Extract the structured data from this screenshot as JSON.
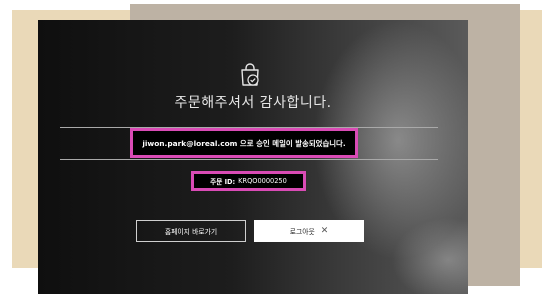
{
  "modal": {
    "title": "주문해주셔서 감사합니다.",
    "email_address": "jiwon.park@loreal.com",
    "email_message": " 으로 승인 메일이 발송되었습니다.",
    "order_id_label": "주문 ID:",
    "order_id_value": "KRQO0000250"
  },
  "buttons": {
    "home_label": "홈페이지 바로가기",
    "logout_label": "로그아웃",
    "logout_close_glyph": "✕"
  },
  "colors": {
    "highlight": "#d94bb5",
    "beige_backdrop": "#ead9b8",
    "taupe_backdrop": "#bdb2a4"
  },
  "icons": {
    "header": "shopping-bag-check-icon"
  }
}
